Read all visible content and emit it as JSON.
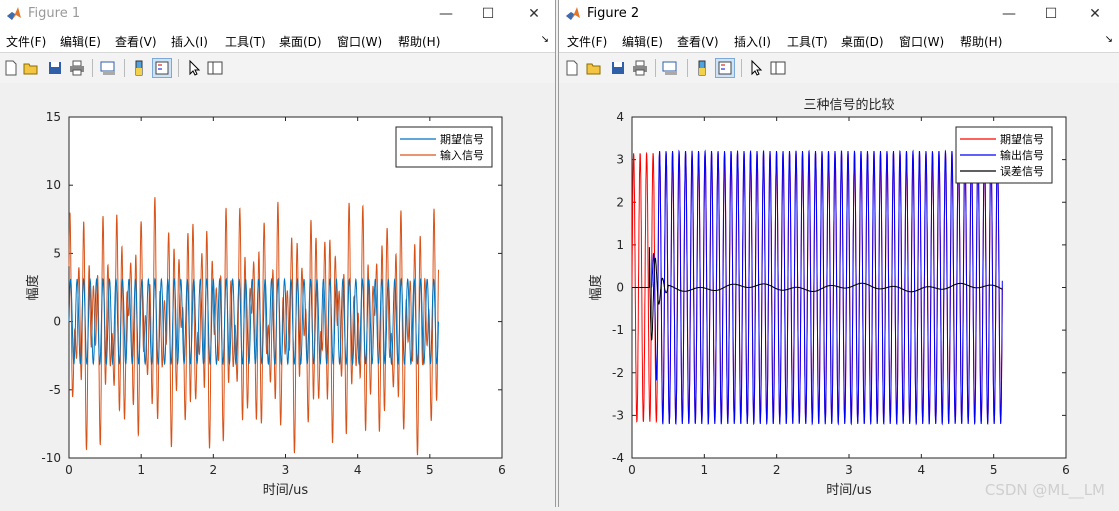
{
  "figure1": {
    "title": "Figure 1",
    "menu": [
      "文件(F)",
      "编辑(E)",
      "查看(V)",
      "插入(I)",
      "工具(T)",
      "桌面(D)",
      "窗口(W)",
      "帮助(H)"
    ],
    "chart": {
      "xlabel": "时间/us",
      "ylabel": "幅度",
      "xticks": [
        "0",
        "1",
        "2",
        "3",
        "4",
        "5",
        "6"
      ],
      "yticks": [
        "-10",
        "-5",
        "0",
        "5",
        "10",
        "15"
      ],
      "legend": [
        "期望信号",
        "输入信号"
      ]
    }
  },
  "figure2": {
    "title": "Figure 2",
    "menu": [
      "文件(F)",
      "编辑(E)",
      "查看(V)",
      "插入(I)",
      "工具(T)",
      "桌面(D)",
      "窗口(W)",
      "帮助(H)"
    ],
    "chart": {
      "title": "三种信号的比较",
      "xlabel": "时间/us",
      "ylabel": "幅度",
      "xticks": [
        "0",
        "1",
        "2",
        "3",
        "4",
        "5",
        "6"
      ],
      "yticks": [
        "-4",
        "-3",
        "-2",
        "-1",
        "0",
        "1",
        "2",
        "3",
        "4"
      ],
      "legend": [
        "期望信号",
        "输出信号",
        "误差信号"
      ]
    }
  },
  "watermark": "CSDN @ML__LM",
  "chart_data": [
    {
      "type": "line",
      "xlabel": "时间/us",
      "ylabel": "幅度",
      "xlim": [
        0,
        6
      ],
      "ylim": [
        -10,
        15
      ],
      "x_range": [
        0,
        5.12
      ],
      "series": [
        {
          "name": "期望信号",
          "color": "#0072BD",
          "amplitude": 3.1,
          "cycles": 57
        },
        {
          "name": "输入信号",
          "color": "#D95319",
          "amplitude_range": [
            -9.5,
            10.3
          ],
          "cycles": 57
        }
      ]
    },
    {
      "type": "line",
      "title": "三种信号的比较",
      "xlabel": "时间/us",
      "ylabel": "幅度",
      "xlim": [
        0,
        6
      ],
      "ylim": [
        -4,
        4
      ],
      "x_range": [
        0,
        5.12
      ],
      "series": [
        {
          "name": "期望信号",
          "color": "#ff0000",
          "amplitude": 3.15,
          "cycles": 57
        },
        {
          "name": "输出信号",
          "color": "#0000ff",
          "amplitude": 3.2,
          "cycles": 57,
          "start_x": 0.27
        },
        {
          "name": "误差信号",
          "color": "#000000",
          "transient_peak": 1.8,
          "steady_amplitude": 0.1
        }
      ]
    }
  ]
}
